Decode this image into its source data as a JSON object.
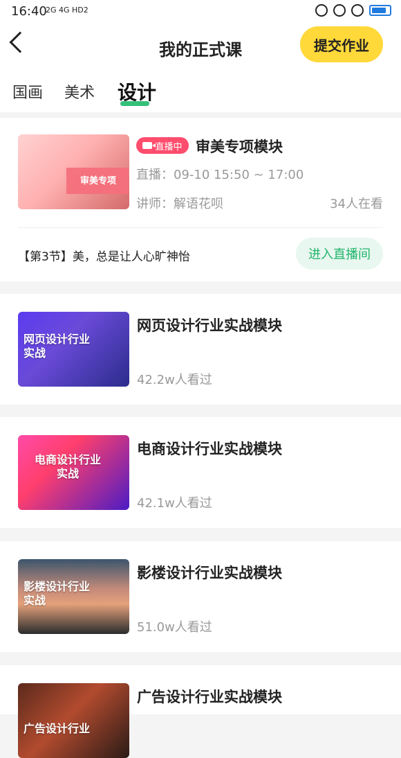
{
  "status_bar": {
    "time": "16:40",
    "network": "2G 4G HD2"
  },
  "header": {
    "title": "我的正式课",
    "submit_label": "提交作业"
  },
  "tabs": [
    {
      "label": "国画"
    },
    {
      "label": "美术"
    },
    {
      "label": "设计"
    }
  ],
  "live": {
    "badge": "直播中",
    "title": "审美专项模块",
    "time": "直播：09-10 15:50 ~ 17:00",
    "teacher": "讲师：解语花呗",
    "viewers": "34人在看",
    "thumb_text": "审美专项",
    "lesson": "【第3节】美，总是让人心旷神怡",
    "enter_label": "进入直播间"
  },
  "courses": [
    {
      "title": "网页设计行业实战模块",
      "views": "42.2w人看过",
      "thumb_text": "网页设计行业\n实战"
    },
    {
      "title": "电商设计行业实战模块",
      "views": "42.1w人看过",
      "thumb_text": "电商设计行业\n实战"
    },
    {
      "title": "影楼设计行业实战模块",
      "views": "51.0w人看过",
      "thumb_text": "影楼设计行业\n实战"
    },
    {
      "title": "广告设计行业实战模块",
      "views": "",
      "thumb_text": "广告设计行业"
    }
  ]
}
